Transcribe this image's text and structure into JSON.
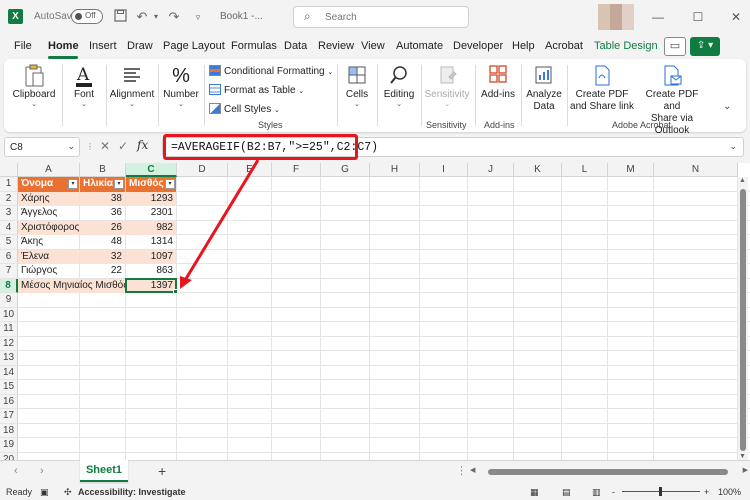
{
  "titlebar": {
    "app_logo": "X",
    "autosave_label": "AutoSave",
    "autosave_state": "Off",
    "doc_title": "Book1 -...",
    "search_placeholder": "Search",
    "icons": [
      "save-icon",
      "undo-icon",
      "redo-icon",
      "customize-icon"
    ]
  },
  "menu": {
    "tabs": [
      "File",
      "Home",
      "Insert",
      "Draw",
      "Page Layout",
      "Formulas",
      "Data",
      "Review",
      "View",
      "Automate",
      "Developer",
      "Help",
      "Acrobat",
      "Table Design"
    ],
    "active": "Home",
    "accent": "#107c41"
  },
  "ribbon": {
    "clipboard": "Clipboard",
    "font": "Font",
    "alignment": "Alignment",
    "number": "Number",
    "conditional_formatting": "Conditional Formatting",
    "format_as_table": "Format as Table",
    "cell_styles": "Cell Styles",
    "styles_group": "Styles",
    "cells": "Cells",
    "editing": "Editing",
    "sensitivity": "Sensitivity",
    "sensitivity_group": "Sensitivity",
    "addins": "Add-ins",
    "addins_group": "Add-ins",
    "analyze_data_1": "Analyze",
    "analyze_data_2": "Data",
    "create_pdf_1": "Create PDF",
    "create_pdf_2": "and Share link",
    "create_pdf_outlook_1": "Create PDF and",
    "create_pdf_outlook_2": "Share via Outlook",
    "acrobat_group": "Adobe Acrobat"
  },
  "formula_bar": {
    "name_box": "C8",
    "fx": "fx",
    "formula": "=AVERAGEIF(B2:B7,\">=25\",C2:C7)"
  },
  "sheet": {
    "columns": [
      "A",
      "B",
      "C",
      "D",
      "E",
      "F",
      "G",
      "H",
      "I",
      "J",
      "K",
      "L",
      "M",
      "N"
    ],
    "rows": [
      "1",
      "2",
      "3",
      "4",
      "5",
      "6",
      "7",
      "8",
      "9",
      "10",
      "11",
      "12",
      "13",
      "14",
      "15",
      "16",
      "17",
      "18",
      "19",
      "20"
    ],
    "selected_cell": "C8",
    "table_header": [
      "Όνομα",
      "Ηλικία",
      "Μισθός"
    ],
    "table_rows": [
      [
        "Χάρης",
        "38",
        "1293"
      ],
      [
        "Άγγελος",
        "36",
        "2301"
      ],
      [
        "Χριστόφορος",
        "26",
        "982"
      ],
      [
        "Άκης",
        "48",
        "1314"
      ],
      [
        "Έλενα",
        "32",
        "1097"
      ],
      [
        "Γιώργος",
        "22",
        "863"
      ]
    ],
    "summary_label": "Μέσος Μηνιαίος Μισθός:",
    "summary_value": "1397",
    "header_color": "#e97132",
    "band_color": "#fbe2d5",
    "callout_color": "#e8141e"
  },
  "tabs": {
    "sheet_name": "Sheet1",
    "add_sheet": "+"
  },
  "status": {
    "ready": "Ready",
    "accessibility": "Accessibility: Investigate",
    "zoom": "100%",
    "zoom_minus": "-",
    "zoom_plus": "+"
  }
}
